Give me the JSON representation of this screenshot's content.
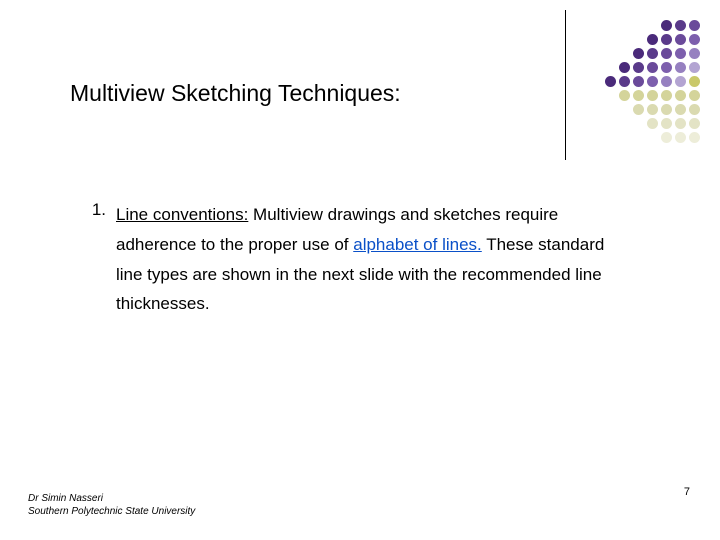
{
  "title": "Multiview Sketching Techniques:",
  "list": {
    "num": "1.",
    "lead": "Line conventions:",
    "seg1": " Multiview drawings and sketches require adherence to the proper use of ",
    "link": "alphabet of lines.",
    "seg2": " These standard line types are shown in the next slide with the recommended line thicknesses."
  },
  "footer": {
    "author": "Dr Simin Nasseri",
    "org": "Southern Polytechnic State University"
  },
  "page_number": "7",
  "decor": {
    "dots": [
      {
        "offset": 4,
        "colors": [
          "#4a2a7a",
          "#5a3a8a",
          "#6a4a9a"
        ]
      },
      {
        "offset": 3,
        "colors": [
          "#4a2a7a",
          "#5a3a8a",
          "#6a4a9a",
          "#7d5fad"
        ]
      },
      {
        "offset": 2,
        "colors": [
          "#4a2a7a",
          "#5a3a8a",
          "#6a4a9a",
          "#7d5fad",
          "#9680c0"
        ]
      },
      {
        "offset": 1,
        "colors": [
          "#4a2a7a",
          "#5a3a8a",
          "#6a4a9a",
          "#7d5fad",
          "#9680c0",
          "#b3a4d2"
        ]
      },
      {
        "offset": 0,
        "colors": [
          "#4a2a7a",
          "#5a3a8a",
          "#6a4a9a",
          "#7d5fad",
          "#9680c0",
          "#b3a4d2",
          "#c9c86a"
        ]
      },
      {
        "offset": 1,
        "colors": [
          "#d4d49a",
          "#d4d49a",
          "#d4d49a",
          "#d4d49a",
          "#d4d49a",
          "#d4d49a"
        ]
      },
      {
        "offset": 2,
        "colors": [
          "#dadab0",
          "#dadab0",
          "#dadab0",
          "#dadab0",
          "#dadab0"
        ]
      },
      {
        "offset": 3,
        "colors": [
          "#e3e3c5",
          "#e3e3c5",
          "#e3e3c5",
          "#e3e3c5"
        ]
      },
      {
        "offset": 4,
        "colors": [
          "#ededd9",
          "#ededd9",
          "#ededd9"
        ]
      }
    ]
  }
}
